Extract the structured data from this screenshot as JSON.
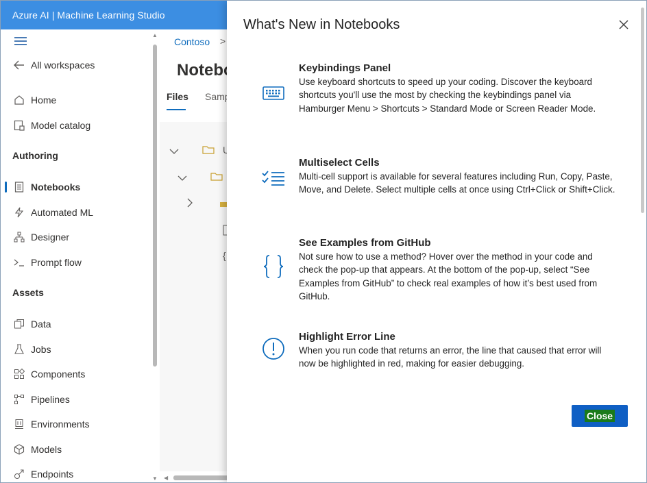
{
  "app": {
    "title": "Azure AI | Machine Learning Studio"
  },
  "sidebar": {
    "back_label": "All workspaces",
    "items_top": [
      {
        "label": "Home",
        "icon": "home-icon"
      },
      {
        "label": "Model catalog",
        "icon": "catalog-icon"
      }
    ],
    "authoring_heading": "Authoring",
    "authoring_items": [
      {
        "label": "Notebooks",
        "icon": "notebook-icon",
        "active": true
      },
      {
        "label": "Automated ML",
        "icon": "lightning-icon"
      },
      {
        "label": "Designer",
        "icon": "designer-icon"
      },
      {
        "label": "Prompt flow",
        "icon": "prompt-flow-icon"
      }
    ],
    "assets_heading": "Assets",
    "assets_items": [
      {
        "label": "Data",
        "icon": "data-icon"
      },
      {
        "label": "Jobs",
        "icon": "flask-icon"
      },
      {
        "label": "Components",
        "icon": "components-icon"
      },
      {
        "label": "Pipelines",
        "icon": "pipelines-icon"
      },
      {
        "label": "Environments",
        "icon": "environments-icon"
      },
      {
        "label": "Models",
        "icon": "cube-icon"
      },
      {
        "label": "Endpoints",
        "icon": "endpoints-icon"
      }
    ]
  },
  "main": {
    "breadcrumb": "Contoso",
    "breadcrumb_sep": ">",
    "page_title": "Notebo",
    "tabs": [
      {
        "label": "Files",
        "selected": true
      },
      {
        "label": "Samp",
        "selected": false
      }
    ],
    "tree_fragments": [
      "U",
      "{"
    ]
  },
  "panel": {
    "title": "What's New in Notebooks",
    "features": [
      {
        "heading": "Keybindings Panel",
        "body": "Use keyboard shortcuts to speed up your coding. Discover the keyboard shortcuts you'll use the most by checking the keybindings panel via Hamburger Menu > Shortcuts > Standard Mode or Screen Reader Mode.",
        "icon": "keyboard-icon"
      },
      {
        "heading": "Multiselect Cells",
        "body": "Multi-cell support is available for several features including Run, Copy, Paste, Move, and Delete. Select multiple cells at once using Ctrl+Click or Shift+Click.",
        "icon": "checklist-icon"
      },
      {
        "heading": "See Examples from GitHub",
        "body": "Not sure how to use a method? Hover over the method in your code and check the pop-up that appears. At the bottom of the pop-up, select “See Examples from GitHub” to check real examples of how it’s best used from GitHub.",
        "icon": "braces-icon"
      },
      {
        "heading": "Highlight Error Line",
        "body": "When you run code that returns an error, the line that caused that error will now be highlighted in red, making for easier debugging.",
        "icon": "error-circle-icon"
      }
    ],
    "close_button_label": "Close"
  },
  "colors": {
    "topbar": "#3c8ee2",
    "accent": "#0f6cbd",
    "close_button": "#0f5fc4",
    "close_text_highlight": "#1a7a1a"
  }
}
